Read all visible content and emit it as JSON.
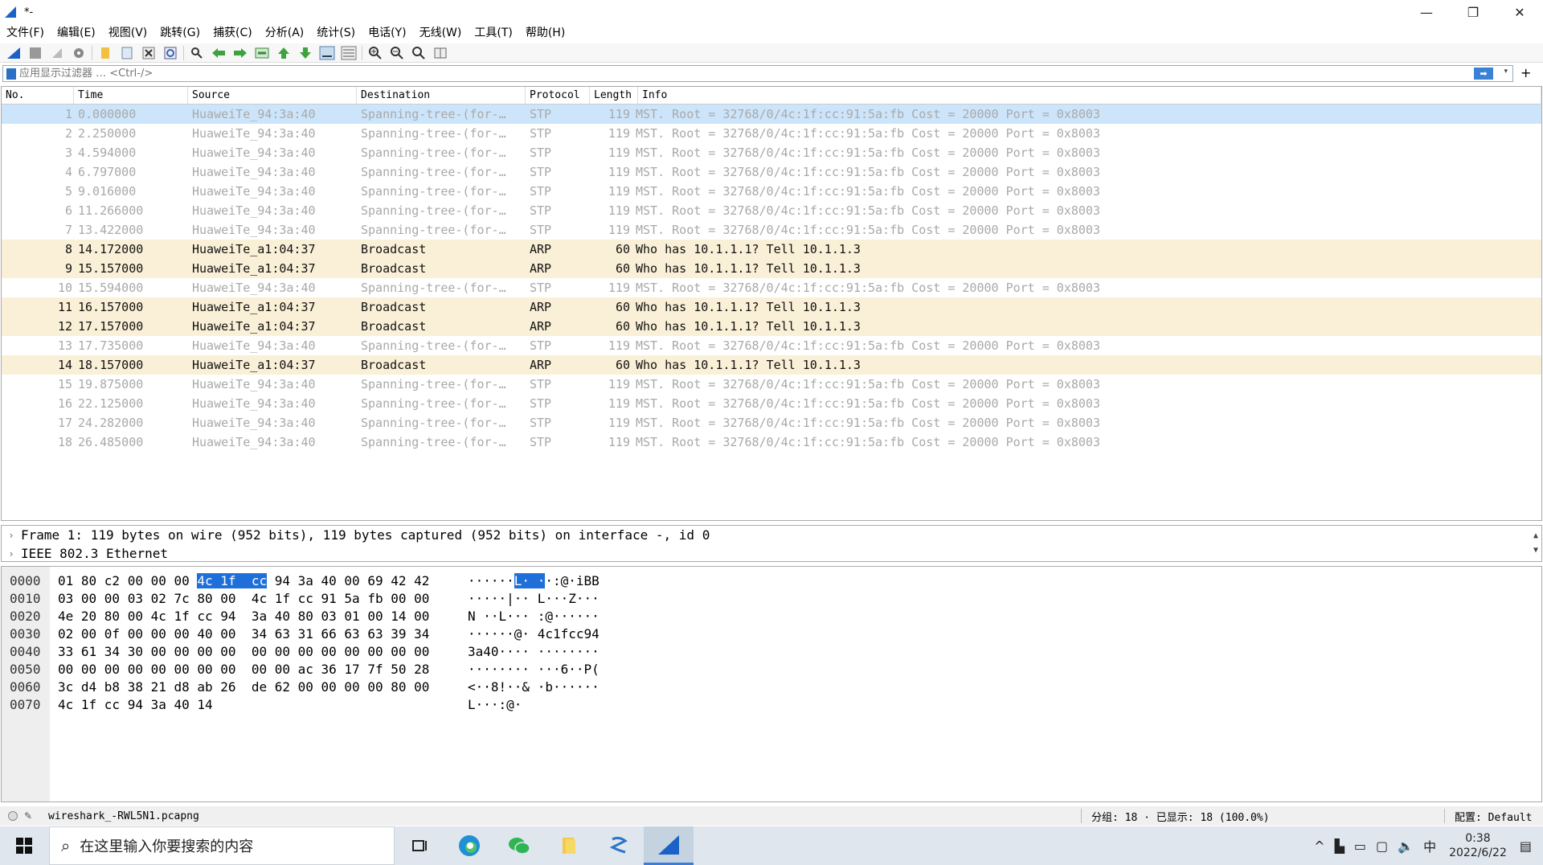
{
  "window": {
    "title": "*-",
    "minimize_glyph": "—",
    "restore_glyph": "❐",
    "close_glyph": "✕"
  },
  "menu": [
    "文件(F)",
    "编辑(E)",
    "视图(V)",
    "跳转(G)",
    "捕获(C)",
    "分析(A)",
    "统计(S)",
    "电话(Y)",
    "无线(W)",
    "工具(T)",
    "帮助(H)"
  ],
  "toolbar": {
    "icons": [
      "shark-fin-start-icon",
      "stop-capture-icon",
      "restart-capture-icon",
      "capture-options-icon",
      "open-file-icon",
      "save-file-icon",
      "close-file-icon",
      "reload-file-icon",
      "find-packet-icon",
      "go-back-icon",
      "go-forward-icon",
      "go-to-packet-icon",
      "go-first-icon",
      "go-last-icon",
      "autoscroll-icon",
      "colorize-icon",
      "zoom-in-icon",
      "zoom-out-icon",
      "zoom-normal-icon",
      "resize-columns-icon"
    ]
  },
  "filter": {
    "placeholder": "应用显示过滤器 … <Ctrl-/>",
    "apply_glyph": "➡",
    "dropdown_glyph": "▾",
    "add_glyph": "+"
  },
  "packet_list": {
    "columns": [
      "No.",
      "Time",
      "Source",
      "Destination",
      "Protocol",
      "Length",
      "Info"
    ],
    "rows": [
      {
        "no": "1",
        "time": "0.000000",
        "src": "HuaweiTe_94:3a:40",
        "dst": "Spanning-tree-(for-…",
        "proto": "STP",
        "len": "119",
        "info": "MST. Root = 32768/0/4c:1f:cc:91:5a:fb  Cost = 20000  Port = 0x8003",
        "kind": "stp",
        "selected": true
      },
      {
        "no": "2",
        "time": "2.250000",
        "src": "HuaweiTe_94:3a:40",
        "dst": "Spanning-tree-(for-…",
        "proto": "STP",
        "len": "119",
        "info": "MST. Root = 32768/0/4c:1f:cc:91:5a:fb  Cost = 20000  Port = 0x8003",
        "kind": "stp"
      },
      {
        "no": "3",
        "time": "4.594000",
        "src": "HuaweiTe_94:3a:40",
        "dst": "Spanning-tree-(for-…",
        "proto": "STP",
        "len": "119",
        "info": "MST. Root = 32768/0/4c:1f:cc:91:5a:fb  Cost = 20000  Port = 0x8003",
        "kind": "stp"
      },
      {
        "no": "4",
        "time": "6.797000",
        "src": "HuaweiTe_94:3a:40",
        "dst": "Spanning-tree-(for-…",
        "proto": "STP",
        "len": "119",
        "info": "MST. Root = 32768/0/4c:1f:cc:91:5a:fb  Cost = 20000  Port = 0x8003",
        "kind": "stp"
      },
      {
        "no": "5",
        "time": "9.016000",
        "src": "HuaweiTe_94:3a:40",
        "dst": "Spanning-tree-(for-…",
        "proto": "STP",
        "len": "119",
        "info": "MST. Root = 32768/0/4c:1f:cc:91:5a:fb  Cost = 20000  Port = 0x8003",
        "kind": "stp"
      },
      {
        "no": "6",
        "time": "11.266000",
        "src": "HuaweiTe_94:3a:40",
        "dst": "Spanning-tree-(for-…",
        "proto": "STP",
        "len": "119",
        "info": "MST. Root = 32768/0/4c:1f:cc:91:5a:fb  Cost = 20000  Port = 0x8003",
        "kind": "stp"
      },
      {
        "no": "7",
        "time": "13.422000",
        "src": "HuaweiTe_94:3a:40",
        "dst": "Spanning-tree-(for-…",
        "proto": "STP",
        "len": "119",
        "info": "MST. Root = 32768/0/4c:1f:cc:91:5a:fb  Cost = 20000  Port = 0x8003",
        "kind": "stp"
      },
      {
        "no": "8",
        "time": "14.172000",
        "src": "HuaweiTe_a1:04:37",
        "dst": "Broadcast",
        "proto": "ARP",
        "len": "60",
        "info": "Who has 10.1.1.1? Tell 10.1.1.3",
        "kind": "arp"
      },
      {
        "no": "9",
        "time": "15.157000",
        "src": "HuaweiTe_a1:04:37",
        "dst": "Broadcast",
        "proto": "ARP",
        "len": "60",
        "info": "Who has 10.1.1.1? Tell 10.1.1.3",
        "kind": "arp"
      },
      {
        "no": "10",
        "time": "15.594000",
        "src": "HuaweiTe_94:3a:40",
        "dst": "Spanning-tree-(for-…",
        "proto": "STP",
        "len": "119",
        "info": "MST. Root = 32768/0/4c:1f:cc:91:5a:fb  Cost = 20000  Port = 0x8003",
        "kind": "stp"
      },
      {
        "no": "11",
        "time": "16.157000",
        "src": "HuaweiTe_a1:04:37",
        "dst": "Broadcast",
        "proto": "ARP",
        "len": "60",
        "info": "Who has 10.1.1.1? Tell 10.1.1.3",
        "kind": "arp"
      },
      {
        "no": "12",
        "time": "17.157000",
        "src": "HuaweiTe_a1:04:37",
        "dst": "Broadcast",
        "proto": "ARP",
        "len": "60",
        "info": "Who has 10.1.1.1? Tell 10.1.1.3",
        "kind": "arp"
      },
      {
        "no": "13",
        "time": "17.735000",
        "src": "HuaweiTe_94:3a:40",
        "dst": "Spanning-tree-(for-…",
        "proto": "STP",
        "len": "119",
        "info": "MST. Root = 32768/0/4c:1f:cc:91:5a:fb  Cost = 20000  Port = 0x8003",
        "kind": "stp"
      },
      {
        "no": "14",
        "time": "18.157000",
        "src": "HuaweiTe_a1:04:37",
        "dst": "Broadcast",
        "proto": "ARP",
        "len": "60",
        "info": "Who has 10.1.1.1? Tell 10.1.1.3",
        "kind": "arp"
      },
      {
        "no": "15",
        "time": "19.875000",
        "src": "HuaweiTe_94:3a:40",
        "dst": "Spanning-tree-(for-…",
        "proto": "STP",
        "len": "119",
        "info": "MST. Root = 32768/0/4c:1f:cc:91:5a:fb  Cost = 20000  Port = 0x8003",
        "kind": "stp"
      },
      {
        "no": "16",
        "time": "22.125000",
        "src": "HuaweiTe_94:3a:40",
        "dst": "Spanning-tree-(for-…",
        "proto": "STP",
        "len": "119",
        "info": "MST. Root = 32768/0/4c:1f:cc:91:5a:fb  Cost = 20000  Port = 0x8003",
        "kind": "stp"
      },
      {
        "no": "17",
        "time": "24.282000",
        "src": "HuaweiTe_94:3a:40",
        "dst": "Spanning-tree-(for-…",
        "proto": "STP",
        "len": "119",
        "info": "MST. Root = 32768/0/4c:1f:cc:91:5a:fb  Cost = 20000  Port = 0x8003",
        "kind": "stp"
      },
      {
        "no": "18",
        "time": "26.485000",
        "src": "HuaweiTe_94:3a:40",
        "dst": "Spanning-tree-(for-…",
        "proto": "STP",
        "len": "119",
        "info": "MST. Root = 32768/0/4c:1f:cc:91:5a:fb  Cost = 20000  Port = 0x8003",
        "kind": "stp"
      }
    ]
  },
  "details": [
    {
      "arrow": "›",
      "text": "Frame 1: 119 bytes on wire (952 bits), 119 bytes captured (952 bits) on interface -, id 0"
    },
    {
      "arrow": "›",
      "text": "IEEE 802.3 Ethernet"
    }
  ],
  "hex_dump": [
    {
      "offset": "0000",
      "hex_pre": "01 80 c2 00 00 00 ",
      "hex_hl": "4c 1f  cc",
      "hex_post": " 94 3a 40 00 69 42 42",
      "ascii_pre": "······",
      "ascii_hl": "L· ·",
      "ascii_post": "·:@·iBB"
    },
    {
      "offset": "0010",
      "hex_pre": "03 00 00 03 02 7c 80 00  4c 1f cc 91 5a fb 00 00",
      "hex_hl": "",
      "hex_post": "",
      "ascii_pre": "·····|·· L···Z···",
      "ascii_hl": "",
      "ascii_post": ""
    },
    {
      "offset": "0020",
      "hex_pre": "4e 20 80 00 4c 1f cc 94  3a 40 80 03 01 00 14 00",
      "hex_hl": "",
      "hex_post": "",
      "ascii_pre": "N ··L··· :@······",
      "ascii_hl": "",
      "ascii_post": ""
    },
    {
      "offset": "0030",
      "hex_pre": "02 00 0f 00 00 00 40 00  34 63 31 66 63 63 39 34",
      "hex_hl": "",
      "hex_post": "",
      "ascii_pre": "······@· 4c1fcc94",
      "ascii_hl": "",
      "ascii_post": ""
    },
    {
      "offset": "0040",
      "hex_pre": "33 61 34 30 00 00 00 00  00 00 00 00 00 00 00 00",
      "hex_hl": "",
      "hex_post": "",
      "ascii_pre": "3a40···· ········",
      "ascii_hl": "",
      "ascii_post": ""
    },
    {
      "offset": "0050",
      "hex_pre": "00 00 00 00 00 00 00 00  00 00 ac 36 17 7f 50 28",
      "hex_hl": "",
      "hex_post": "",
      "ascii_pre": "········ ···6··P(",
      "ascii_hl": "",
      "ascii_post": ""
    },
    {
      "offset": "0060",
      "hex_pre": "3c d4 b8 38 21 d8 ab 26  de 62 00 00 00 00 80 00",
      "hex_hl": "",
      "hex_post": "",
      "ascii_pre": "<··8!··& ·b······",
      "ascii_hl": "",
      "ascii_post": ""
    },
    {
      "offset": "0070",
      "hex_pre": "4c 1f cc 94 3a 40 14",
      "hex_hl": "",
      "hex_post": "",
      "ascii_pre": "L···:@·",
      "ascii_hl": "",
      "ascii_post": ""
    }
  ],
  "status": {
    "file": "wireshark_-RWL5N1.pcapng",
    "counts": "分组: 18 · 已显示: 18 (100.0%)",
    "profile": "配置: Default"
  },
  "taskbar": {
    "search_placeholder": "在这里输入你要搜索的内容",
    "tray_ime": "中",
    "time": "0:38",
    "date": "2022/6/22",
    "tray_caret": "^"
  }
}
